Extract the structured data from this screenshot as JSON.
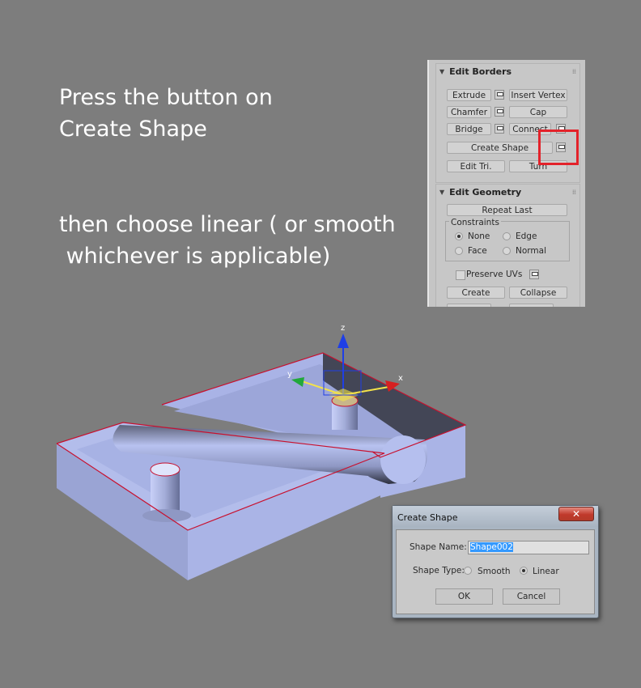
{
  "instructions": {
    "line1": "Press the button on\nCreate Shape",
    "line2": "then choose linear ( or smooth\n whichever is applicable)"
  },
  "panel": {
    "edit_borders": {
      "title": "Edit Borders",
      "extrude": "Extrude",
      "insert_vertex": "Insert Vertex",
      "chamfer": "Chamfer",
      "cap": "Cap",
      "bridge": "Bridge",
      "connect": "Connect",
      "create_shape": "Create Shape",
      "edit_tri": "Edit Tri.",
      "turn": "Turn"
    },
    "edit_geometry": {
      "title": "Edit Geometry",
      "repeat_last": "Repeat Last",
      "constraints": "Constraints",
      "none": "None",
      "edge": "Edge",
      "face": "Face",
      "normal": "Normal",
      "preserve_uvs": "Preserve UVs",
      "create": "Create",
      "collapse": "Collapse"
    }
  },
  "gizmo": {
    "x": "x",
    "y": "y",
    "z": "z"
  },
  "dialog": {
    "title": "Create Shape",
    "close": "✕",
    "shape_name_label": "Shape Name:",
    "shape_name_value": "Shape002",
    "shape_type_label": "Shape Type:",
    "smooth": "Smooth",
    "linear": "Linear",
    "ok": "OK",
    "cancel": "Cancel",
    "selected_type": "Linear"
  },
  "colors": {
    "background": "#7d7d7d",
    "highlight_box": "#e3222a",
    "model_face": "#a7b2e4",
    "edge_selection": "#c8102e"
  }
}
